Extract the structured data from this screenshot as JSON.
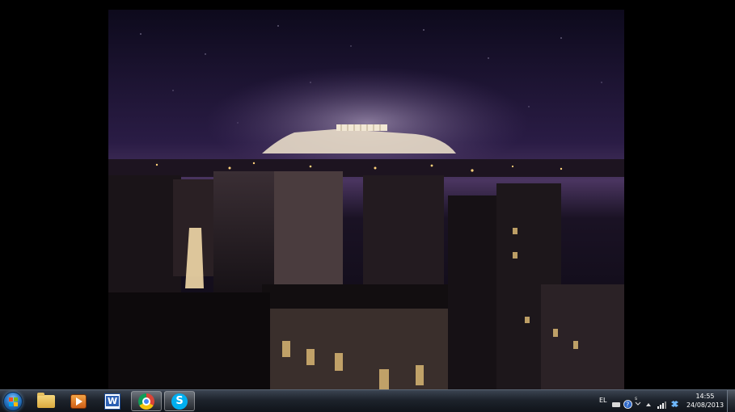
{
  "desktop": {
    "wallpaper_description_icon": "acropolis-night-wallpaper"
  },
  "taskbar": {
    "start_icon": "windows-start-orb-icon",
    "pinned": [
      {
        "name": "windows-explorer",
        "icon": "folder-icon"
      },
      {
        "name": "windows-media-player",
        "icon": "media-player-icon"
      },
      {
        "name": "microsoft-word",
        "icon": "word-icon"
      },
      {
        "name": "google-chrome",
        "icon": "chrome-icon",
        "active": true
      },
      {
        "name": "skype",
        "icon": "skype-icon",
        "active": true
      }
    ],
    "tray": {
      "language": "EL",
      "time": "14:55",
      "date": "24/08/2013"
    }
  },
  "colors": {
    "taskbar_top": "#3b4451",
    "taskbar_bottom": "#10141a",
    "sky": "#1a1230"
  }
}
